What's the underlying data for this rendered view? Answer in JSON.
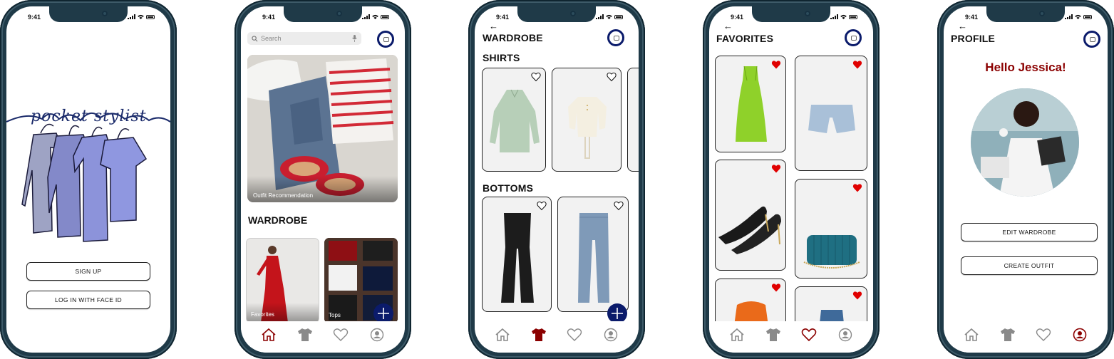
{
  "status": {
    "time": "9:41"
  },
  "screen1": {
    "logo_text": "pocket stylist",
    "signup_label": "SIGN UP",
    "login_label": "LOG IN WITH FACE ID"
  },
  "screen2": {
    "search_placeholder": "Search",
    "hero_caption": "Outfit Recommendation",
    "section_title": "WARDROBE",
    "tiles": [
      {
        "label": "Favorites"
      },
      {
        "label": "Tops"
      }
    ]
  },
  "screen3": {
    "title": "WARDROBE",
    "shirts_heading": "SHIRTS",
    "bottoms_heading": "BOTTOMS"
  },
  "screen4": {
    "title": "FAVORITES"
  },
  "screen5": {
    "title": "PROFILE",
    "greeting": "Hello Jessica!",
    "edit_label": "EDIT WARDROBE",
    "create_label": "CREATE OUTFIT"
  },
  "colors": {
    "accent_red": "#8b0000",
    "heart_red": "#e00000",
    "navy": "#0b1b6b",
    "phone_frame": "#1f3a48"
  }
}
